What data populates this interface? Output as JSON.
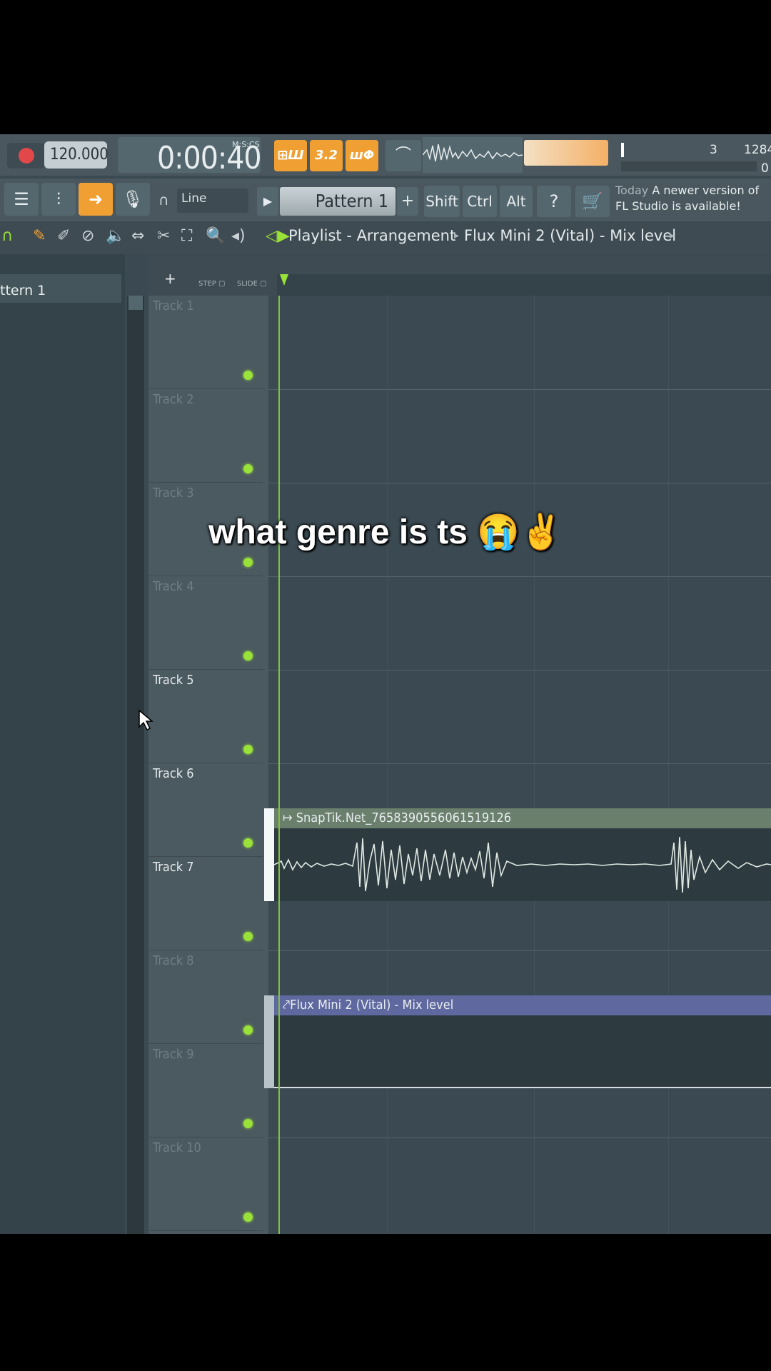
{
  "toolbar": {
    "tempo": "120.000",
    "time": "0:00:40",
    "time_format": "M:S:CS",
    "orange_buttons": [
      "⊞Ш",
      "3.2",
      "шΦ"
    ],
    "cpu_val1": "3",
    "cpu_val2": "1284",
    "cpu_val3": "0",
    "snap_mode": "Line",
    "pattern": "Pattern 1",
    "pattern_add": "+",
    "keys": [
      "Shift",
      "Ctrl",
      "Alt"
    ],
    "news_today": "Today",
    "news_text": "A newer version of FL Studio is available!"
  },
  "breadcrumb": {
    "root": "Playlist - Arrangement",
    "child": "Flux Mini 2 (Vital) - Mix level"
  },
  "playlist_head": {
    "step": "STEP",
    "slide": "SLIDE",
    "add": "+"
  },
  "pattern_panel": {
    "item": "ttern 1"
  },
  "tracks": [
    {
      "name": "Track 1",
      "active": false
    },
    {
      "name": "Track 2",
      "active": false
    },
    {
      "name": "Track 3",
      "active": false
    },
    {
      "name": "Track 4",
      "active": false
    },
    {
      "name": "Track 5",
      "active": true
    },
    {
      "name": "Track 6",
      "active": true
    },
    {
      "name": "Track 7",
      "active": true
    },
    {
      "name": "Track 8",
      "active": false
    },
    {
      "name": "Track 9",
      "active": false
    },
    {
      "name": "Track 10",
      "active": false
    }
  ],
  "clips": {
    "audio": "SnapTik.Net_7658390556061519126",
    "automation": "Flux Mini 2 (Vital) - Mix level"
  },
  "caption": "what genre is ts 😭✌️",
  "colors": {
    "accent_orange": "#f0a033",
    "led_green": "#9ae13a",
    "record_red": "#e2484a"
  }
}
